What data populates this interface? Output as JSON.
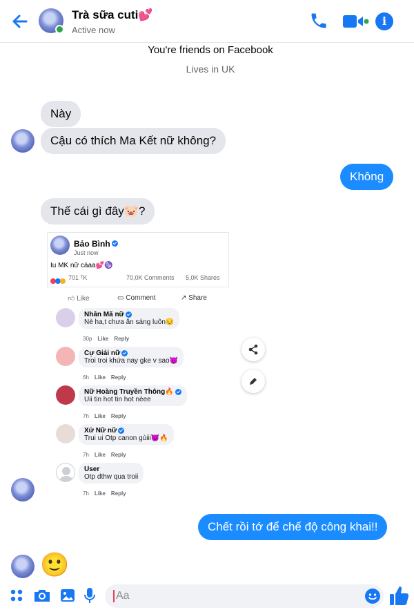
{
  "header": {
    "contact_name": "Trà sữa cuti💕",
    "status": "Active now"
  },
  "profile_info": {
    "friends_line": "You're friends on Facebook",
    "location_line": "Lives in UK"
  },
  "messages": {
    "in_1": "Này",
    "in_2": "Cậu có thích Ma Kết nữ không?",
    "out_1": "Không",
    "in_3": "Thế cái gì đây🐷?",
    "out_2": "Chết rồi tớ để chế độ công khai!!"
  },
  "shared_post": {
    "author": "Bảo Bình",
    "time": "Just now",
    "text": "Iu MK nữ cáaa💕♑",
    "reaction_count": "701 ᵀK",
    "comments_count": "70,0K Comments",
    "shares_count": "5,0K Shares",
    "actions": {
      "like": "Like",
      "comment": "Comment",
      "share": "Share"
    },
    "comments": [
      {
        "name": "Nhân Mã nữ",
        "text": "Nè ha,t chưa ăn sáng luôn😔",
        "time": "30p",
        "like": "Like",
        "reply": "Reply",
        "avatar_color": "#d9cfe8"
      },
      {
        "name": "Cự Giải nữ",
        "text": "Troi troi khứa nay gke v sao😈",
        "time": "6h",
        "like": "Like",
        "reply": "Reply",
        "avatar_color": "#f3b5b5"
      },
      {
        "name": "Nữ Hoàng Truyền Thông🔥",
        "text": "Uii tin hot tin hot nèee",
        "time": "7h",
        "like": "Like",
        "reply": "Reply",
        "avatar_color": "#c0394a"
      },
      {
        "name": "Xử Nữ nữ",
        "text": "Trui ui Otp canon gùiii😈🔥",
        "time": "7h",
        "like": "Like",
        "reply": "Reply",
        "avatar_color": "#e8ddd6"
      },
      {
        "name": "User",
        "text": "Otp dthw qua troii",
        "time": "7h",
        "like": "Like",
        "reply": "Reply",
        "avatar_color": "#ffffff"
      }
    ]
  },
  "reaction_emoji": "🙂",
  "composer": {
    "placeholder": "Aa"
  },
  "colors": {
    "accent": "#1877f2",
    "outgoing_bubble": "#1a8cff",
    "incoming_bubble": "#e4e6eb",
    "online_dot": "#31a24c"
  }
}
